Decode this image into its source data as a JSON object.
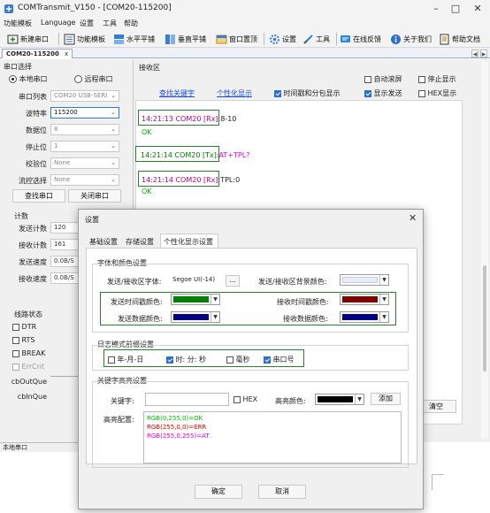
{
  "window": {
    "title": "COMTransmit_V150 - [COM20-115200]"
  },
  "menu": [
    "功能模板",
    "Language",
    "设置",
    "工具",
    "帮助"
  ],
  "toolbar": {
    "items": [
      "新建串口",
      "功能模板",
      "水平平铺",
      "垂直平铺",
      "窗口置顶",
      "设置",
      "工具",
      "在线反馈",
      "关于我们",
      "帮助文档"
    ]
  },
  "doc_tab": {
    "label": "COM20-115200",
    "close": "x"
  },
  "left": {
    "port_select_title": "串口选择",
    "local_label": "本地串口",
    "remote_label": "远程串口",
    "fields": [
      {
        "label": "串口列表",
        "value": "COM20  USB-SERI"
      },
      {
        "label": "波特率",
        "value": "115200"
      },
      {
        "label": "数据位",
        "value": "8"
      },
      {
        "label": "停止位",
        "value": "1"
      },
      {
        "label": "校验位",
        "value": "None"
      },
      {
        "label": "流控选择",
        "value": "None"
      }
    ],
    "find_port": "查找串口",
    "close_port": "关闭串口",
    "count_title": "计数",
    "counts": [
      {
        "label": "发送计数",
        "value": "120"
      },
      {
        "label": "接收计数",
        "value": "161"
      },
      {
        "label": "发送速度",
        "value": "0.0B/S"
      },
      {
        "label": "接收速度",
        "value": "0.0B/S"
      }
    ],
    "line_title": "线路状态",
    "lines": [
      "DTR",
      "RTS",
      "BREAK",
      "ErrCnt"
    ],
    "queues": [
      "cbOutQue",
      "cbInQue"
    ]
  },
  "recv": {
    "title": "接收区",
    "find_keyword": "查找关键字",
    "personal_display": "个性化显示",
    "time_and_packet": "时间戳和分包显示",
    "auto_scroll": "自动滚屏",
    "stop_display": "停止显示",
    "show_send": "显示发送",
    "hex_display": "HEX显示",
    "clear_btn": "清空",
    "lines": [
      {
        "ts": "14:21:13 COM20 [Rx]:",
        "data": "8-10",
        "ok": "OK"
      },
      {
        "ts": "14:21:14 COM20 [Tx]:",
        "data": "AT+TPL?",
        "ok": ""
      },
      {
        "ts": "14:21:14 COM20 [Rx]:",
        "data": "TPL:0",
        "ok": "OK"
      }
    ]
  },
  "statusbar": {
    "text": "本地串口"
  },
  "dialog": {
    "title": "设置",
    "tabs": [
      "基础设置",
      "存储设置",
      "个性化显示设置"
    ],
    "font_group": "字体和颜色设置",
    "font_label": "发送/接收区字体:",
    "font_value": "Segoe UI(-14)",
    "font_btn": "...",
    "bg_label": "发送/接收区背景颜色:",
    "send_ts_color": "发送时间戳颜色:",
    "recv_ts_color": "接收时间戳颜色:",
    "send_data_color": "发送数据颜色:",
    "recv_data_color": "接收数据颜色:",
    "log_group": "日志模式前缀设置",
    "prefix": [
      {
        "label": "年-月-日",
        "on": false
      },
      {
        "label": "时: 分: 秒",
        "on": true
      },
      {
        "label": "毫秒",
        "on": false
      },
      {
        "label": "串口号",
        "on": true
      }
    ],
    "kw_group": "关键字高亮设置",
    "kw_label": "关键字:",
    "kw_hex": "HEX",
    "hl_color": "高亮颜色:",
    "add_btn": "添加",
    "hl_config": "高亮配置:",
    "hl_lines": [
      {
        "text": "RGB(0,255,0)=OK",
        "color": "#00c000"
      },
      {
        "text": "RGB(255,0,0)=ERR",
        "color": "#e00000"
      },
      {
        "text": "RGB(255,0,255)=AT",
        "color": "#e000e0"
      }
    ],
    "ok": "确定",
    "cancel": "取消"
  },
  "colors": {
    "timestamp_color": "#c0007a",
    "ok_color": "#00b000",
    "send_ts": "#008000",
    "recv_ts": "#800000",
    "send_data": "#000080",
    "recv_data": "#000080",
    "bg": "#e6ecff",
    "highlight": "#000000",
    "accent_box": "#2e7d32"
  }
}
